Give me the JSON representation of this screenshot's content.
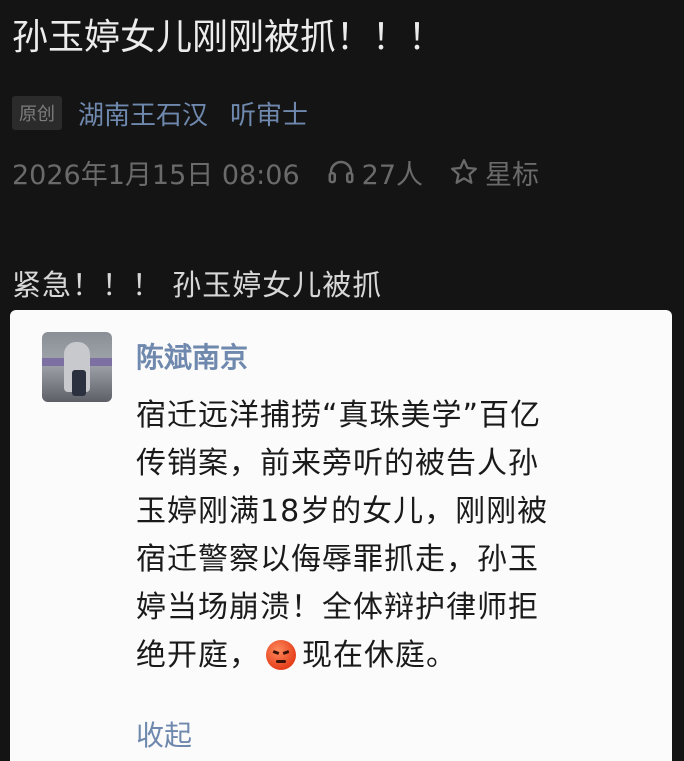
{
  "article": {
    "title": "孙玉婷女儿刚刚被抓！！！",
    "badge": "原创",
    "authors": [
      "湖南王石汉",
      "听审士"
    ],
    "date": "2026年1月15日 08:06",
    "listeners": "27人",
    "star_label": "星标",
    "lead": "紧急！！！ 孙玉婷女儿被抓"
  },
  "card": {
    "name": "陈斌南京",
    "lines": [
      "宿迁远洋捕捞“真珠美学”百亿",
      "传销案，前来旁听的被告人孙",
      "玉婷刚满18岁的女儿，刚刚被",
      "宿迁警察以侮辱罪抓走，孙玉",
      "婷当场崩溃！全体辩护律师拒"
    ],
    "last_line_before": "绝开庭，",
    "last_line_after": "现在休庭。",
    "emoji": "angry-face-emoji",
    "collapse_label": "收起"
  },
  "colors": {
    "background": "#141414",
    "link": "#6f88ad",
    "muted": "#6a6a6a",
    "card": "#fbfbfb"
  },
  "icons": {
    "listen": "headphones-icon",
    "star": "star-outline-icon"
  }
}
